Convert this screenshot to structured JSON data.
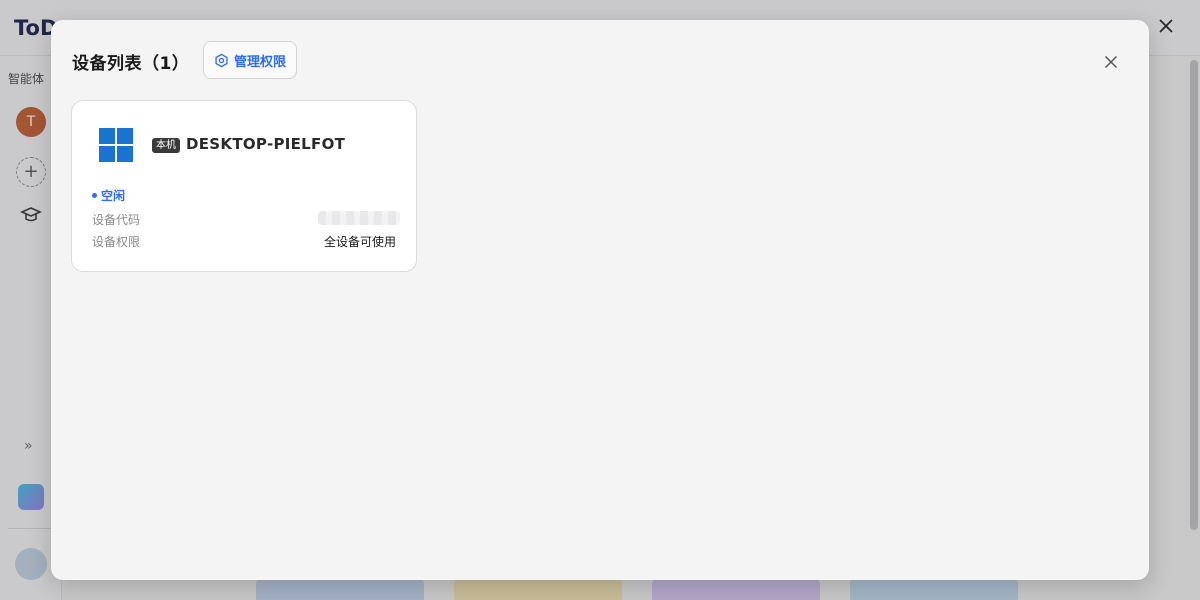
{
  "background": {
    "app_logo": "ToD",
    "sidebar_label": "智能体",
    "avatar_letter": "T",
    "add_symbol": "+",
    "expand_symbol": "»"
  },
  "modal": {
    "title": "设备列表（1）",
    "manage_permissions_label": "管理权限",
    "devices": [
      {
        "os_icon": "windows-icon",
        "local_badge": "本机",
        "name": "DESKTOP-PIELFOT",
        "status": "空闲",
        "code_label": "设备代码",
        "permission_label": "设备权限",
        "permission_value": "全设备可使用"
      }
    ]
  },
  "colors": {
    "accent": "#2f6ee8",
    "windows_blue": "#1a73d0",
    "avatar": "#c86a3f"
  }
}
